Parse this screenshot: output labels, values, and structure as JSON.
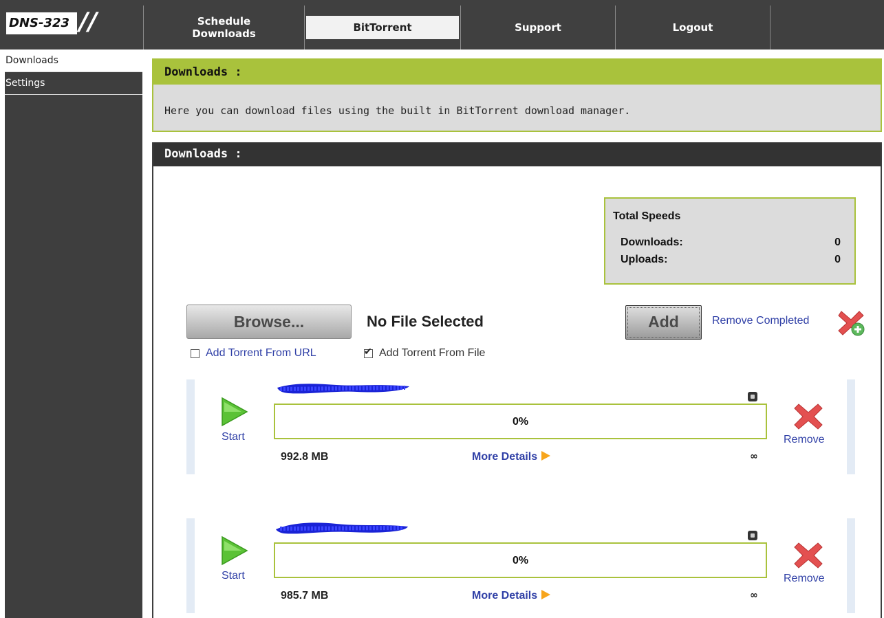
{
  "header": {
    "logo_text": "DNS-323",
    "nav": [
      {
        "label": "Schedule Downloads",
        "active": false
      },
      {
        "label": "BitTorrent",
        "active": true
      },
      {
        "label": "Support",
        "active": false
      },
      {
        "label": "Logout",
        "active": false
      }
    ]
  },
  "sidebar": {
    "items": [
      {
        "label": "Downloads",
        "active": true
      },
      {
        "label": "Settings",
        "active": false
      }
    ]
  },
  "info_panel": {
    "title": "Downloads :",
    "text": "Here you can download files using the built in BitTorrent download manager."
  },
  "downloads_panel": {
    "title": "Downloads :",
    "speeds": {
      "title": "Total Speeds",
      "downloads_label": "Downloads:",
      "downloads_value": "0",
      "uploads_label": "Uploads:",
      "uploads_value": "0"
    },
    "browse_label": "Browse...",
    "file_status": "No File Selected",
    "add_label": "Add",
    "remove_completed_label": "Remove Completed",
    "options": {
      "from_url_label": "Add Torrent From URL",
      "from_url_checked": false,
      "from_file_label": "Add Torrent From File",
      "from_file_checked": true
    },
    "torrents": [
      {
        "start_label": "Start",
        "progress_text": "0%",
        "progress_value": 0,
        "size": "992.8 MB",
        "more_label": "More Details",
        "eta": "∞",
        "remove_label": "Remove"
      },
      {
        "start_label": "Start",
        "progress_text": "0%",
        "progress_value": 0,
        "size": "985.7 MB",
        "more_label": "More Details",
        "eta": "∞",
        "remove_label": "Remove"
      }
    ]
  },
  "colors": {
    "accent_green": "#a9c23c",
    "dark": "#404040",
    "link_blue": "#2f3fa6",
    "panel_grey": "#dcdcdc",
    "arrow_orange": "#f7a51c"
  },
  "icons": {
    "start": "play-triangle-icon",
    "remove": "red-x-icon",
    "remove_completed": "red-x-with-plus-icon",
    "stop": "stop-square-icon",
    "more_details": "orange-arrow-icon"
  }
}
